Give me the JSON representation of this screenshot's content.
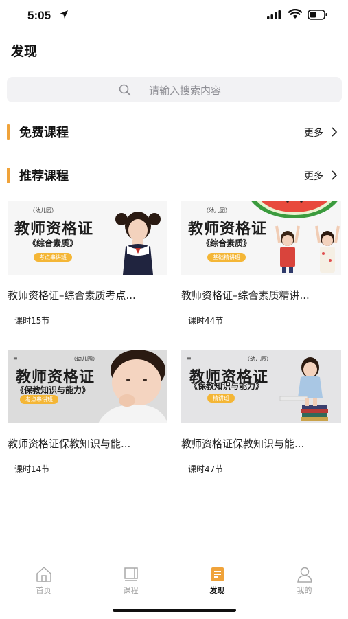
{
  "status_bar": {
    "time": "5:05"
  },
  "page": {
    "title": "发现"
  },
  "search": {
    "placeholder": "请输入搜索内容"
  },
  "sections": {
    "free": {
      "title": "免费课程",
      "more": "更多"
    },
    "recommended": {
      "title": "推荐课程",
      "more": "更多"
    }
  },
  "courses": [
    {
      "title": "教师资格证–综合素质考点...",
      "lessons": "课时15节",
      "thumb": {
        "sub": "（幼儿园）",
        "main": "教师资格证",
        "paren": "《综合素质》",
        "badge": "考点串讲班"
      }
    },
    {
      "title": "教师资格证–综合素质精讲...",
      "lessons": "课时44节",
      "thumb": {
        "sub": "（幼儿园）",
        "main": "教师资格证",
        "paren": "《综合素质》",
        "badge": "基础精讲班"
      }
    },
    {
      "title": "教师资格证保教知识与能...",
      "lessons": "课时14节",
      "thumb": {
        "sub": "（幼儿园）",
        "main": "教师资格证",
        "paren": "《保教知识与能力》",
        "badge": "考点串讲班"
      }
    },
    {
      "title": "教师资格证保教知识与能...",
      "lessons": "课时47节",
      "thumb": {
        "sub": "（幼儿园）",
        "main": "教师资格证",
        "paren": "《保教知识与能力》",
        "badge": "精讲班"
      }
    }
  ],
  "tabs": [
    {
      "label": "首页",
      "icon": "home-icon",
      "active": false
    },
    {
      "label": "课程",
      "icon": "course-icon",
      "active": false
    },
    {
      "label": "发现",
      "icon": "discover-icon",
      "active": true
    },
    {
      "label": "我的",
      "icon": "profile-icon",
      "active": false
    }
  ],
  "colors": {
    "accent": "#f0a33a",
    "badge": "#f4b636",
    "inactive_tab": "#9b9b9b"
  }
}
